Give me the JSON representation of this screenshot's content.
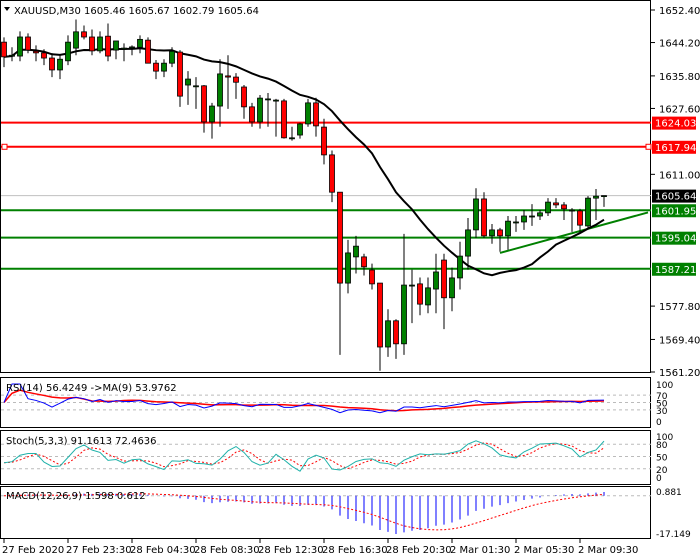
{
  "header": {
    "symbol": "XAUUSD,M30",
    "ohlc": "1605.46 1605.67 1602.79 1605.64",
    "menu_icon": "triangle-down-icon"
  },
  "colors": {
    "bull": "#008000",
    "bear": "#ff0000",
    "resistance": "#ff0000",
    "support": "#008000",
    "ma": "#000000",
    "rsi": "#0000ff",
    "rsi_ma": "#ff0000",
    "stoch_main": "#20b2aa",
    "stoch_signal": "#ff0000",
    "macd": "#0000ff",
    "macd_signal": "#ff0000",
    "last_price": "#000000"
  },
  "chart_data": {
    "type": "candlestick",
    "title": "XAUUSD,M30",
    "ylim": [
      1561.2,
      1652.4
    ],
    "price_ticks": [
      "1652.40",
      "1644.20",
      "1635.80",
      "1627.60",
      "1611.00",
      "1577.80",
      "1569.40",
      "1561.20"
    ],
    "price_tick_values": [
      1652.4,
      1644.2,
      1635.8,
      1627.6,
      1611.0,
      1577.8,
      1569.4,
      1561.2
    ],
    "time_labels": [
      "27 Feb 2020",
      "27 Feb 23:30",
      "28 Feb 04:30",
      "28 Feb 08:30",
      "28 Feb 12:30",
      "28 Feb 16:30",
      "28 Feb 20:30",
      "2 Mar 01:30",
      "2 Mar 05:30",
      "2 Mar 09:30"
    ],
    "time_label_every_bars": 8,
    "ma_period": 20,
    "candles": [
      [
        1644.3,
        1645.5,
        1638,
        1640.6
      ],
      [
        1641,
        1643,
        1639.5,
        1641
      ],
      [
        1640.8,
        1647,
        1639.5,
        1645.6
      ],
      [
        1645.6,
        1646.5,
        1641.5,
        1642.3
      ],
      [
        1642,
        1643.5,
        1639.5,
        1641.6
      ],
      [
        1641.6,
        1642.5,
        1638.5,
        1640.3
      ],
      [
        1640.3,
        1641.5,
        1635.5,
        1637.3
      ],
      [
        1637.3,
        1641,
        1635,
        1640
      ],
      [
        1639.6,
        1646,
        1638.5,
        1644.3
      ],
      [
        1642.8,
        1650,
        1641,
        1646.9
      ],
      [
        1646.9,
        1648.5,
        1645,
        1645.6
      ],
      [
        1645.6,
        1647.5,
        1641,
        1642.1
      ],
      [
        1642.1,
        1647,
        1641.5,
        1645.6
      ],
      [
        1645.8,
        1649,
        1639.5,
        1640.8
      ],
      [
        1642.3,
        1644.6,
        1640,
        1644.6
      ],
      [
        1642.8,
        1644,
        1639.5,
        1642.8
      ],
      [
        1643.1,
        1643.5,
        1641,
        1643.1
      ],
      [
        1643,
        1646,
        1641.5,
        1645
      ],
      [
        1644.8,
        1645.5,
        1639,
        1639
      ],
      [
        1639,
        1639.8,
        1635,
        1637
      ],
      [
        1637,
        1640,
        1635.5,
        1639
      ],
      [
        1639,
        1643,
        1638,
        1642
      ],
      [
        1641.8,
        1642.3,
        1628,
        1630.7
      ],
      [
        1633.5,
        1637,
        1628.5,
        1635
      ],
      [
        1633.3,
        1635.5,
        1627.5,
        1633.3
      ],
      [
        1633.3,
        1633.5,
        1621.5,
        1624.2
      ],
      [
        1624.2,
        1629,
        1620,
        1628.2
      ],
      [
        1628.2,
        1640,
        1623,
        1636.3
      ],
      [
        1635.8,
        1641,
        1627.5,
        1635.5
      ],
      [
        1635.5,
        1636.5,
        1630,
        1634.2
      ],
      [
        1633,
        1633.5,
        1625,
        1628
      ],
      [
        1628,
        1629,
        1623,
        1624.2
      ],
      [
        1624.2,
        1631,
        1622.5,
        1630.2
      ],
      [
        1630,
        1631.5,
        1623,
        1630
      ],
      [
        1629.7,
        1630,
        1620.5,
        1629.7
      ],
      [
        1629.5,
        1630,
        1620,
        1620.2
      ],
      [
        1620.2,
        1623,
        1619.5,
        1620.2
      ],
      [
        1620.9,
        1624,
        1620,
        1623.7
      ],
      [
        1623.7,
        1630,
        1623,
        1629
      ],
      [
        1629,
        1630.3,
        1620.5,
        1623.2
      ],
      [
        1622.9,
        1625,
        1613.5,
        1615.9
      ],
      [
        1615.9,
        1617,
        1604,
        1606.5
      ],
      [
        1606.5,
        1606.5,
        1565.5,
        1583.6
      ],
      [
        1583.6,
        1594.5,
        1581,
        1591.2
      ],
      [
        1590.2,
        1595.5,
        1586,
        1592.9
      ],
      [
        1590.2,
        1591,
        1585.5,
        1587.7
      ],
      [
        1586.9,
        1588.5,
        1582,
        1583.4
      ],
      [
        1583.6,
        1583.6,
        1561.5,
        1567.5
      ],
      [
        1567.5,
        1577,
        1565,
        1574.1
      ],
      [
        1574.1,
        1574.5,
        1564.5,
        1568.3
      ],
      [
        1568.3,
        1596,
        1565.5,
        1583.1
      ],
      [
        1583.1,
        1587,
        1573.5,
        1583.1
      ],
      [
        1583.4,
        1585,
        1575.5,
        1578.3
      ],
      [
        1578.1,
        1585,
        1576,
        1582.4
      ],
      [
        1582.1,
        1591,
        1576,
        1586.4
      ],
      [
        1589.4,
        1591,
        1572,
        1579.9
      ],
      [
        1579.9,
        1587.5,
        1576.5,
        1584.9
      ],
      [
        1584.9,
        1594,
        1582,
        1590.4
      ],
      [
        1590.4,
        1600,
        1587,
        1597
      ],
      [
        1597,
        1607.5,
        1595,
        1604.8
      ],
      [
        1604.8,
        1606.5,
        1595,
        1595.5
      ],
      [
        1595.5,
        1598.5,
        1593.5,
        1597
      ],
      [
        1597,
        1597.5,
        1591.5,
        1595.5
      ],
      [
        1595.5,
        1600.5,
        1592,
        1599.2
      ],
      [
        1599,
        1600.5,
        1596.5,
        1599
      ],
      [
        1599,
        1602,
        1597,
        1600.5
      ],
      [
        1600.5,
        1603.5,
        1598,
        1600.5
      ],
      [
        1600.5,
        1602,
        1599.5,
        1601.3
      ],
      [
        1601.3,
        1605,
        1600.5,
        1604
      ],
      [
        1603.8,
        1605,
        1602.5,
        1603.3
      ],
      [
        1603.3,
        1604,
        1599.5,
        1602.3
      ],
      [
        1602,
        1602.5,
        1596.5,
        1602
      ],
      [
        1601.8,
        1602.3,
        1596.5,
        1598.2
      ],
      [
        1598,
        1605.5,
        1597.5,
        1605
      ],
      [
        1605,
        1607.3,
        1599.5,
        1605.5
      ],
      [
        1605.46,
        1605.67,
        1602.79,
        1605.64
      ]
    ],
    "levels": [
      {
        "price": 1624.03,
        "label": "1624.03",
        "kind": "resistance"
      },
      {
        "price": 1617.94,
        "label": "1617.94",
        "kind": "resistance"
      },
      {
        "price": 1601.95,
        "label": "1601.95",
        "kind": "support"
      },
      {
        "price": 1595.04,
        "label": "1595.04",
        "kind": "support"
      },
      {
        "price": 1587.21,
        "label": "1587.21",
        "kind": "support"
      }
    ],
    "last_price": {
      "price": 1605.64,
      "label": "1605.64"
    },
    "trendline": {
      "start_bar": 62,
      "start_price": 1591.2,
      "end_bar": 80.5,
      "end_price": 1601.4
    },
    "rsi": {
      "label": "RSI(14) 56.4249  ->MA(9) 53.9762",
      "levels": [
        70,
        50,
        30
      ],
      "ticks": [
        "100",
        "70",
        "50",
        "30",
        "0"
      ]
    },
    "stoch": {
      "label": "Stoch(5,3,3) 91.1613 72.4636",
      "levels": [
        80,
        50,
        20
      ],
      "ticks": [
        "100",
        "80",
        "50",
        "20",
        "0"
      ]
    },
    "macd": {
      "label": "MACD(12,26,9) 1.598 0.612",
      "ticks": [
        "0.881",
        "-17.149"
      ]
    }
  }
}
